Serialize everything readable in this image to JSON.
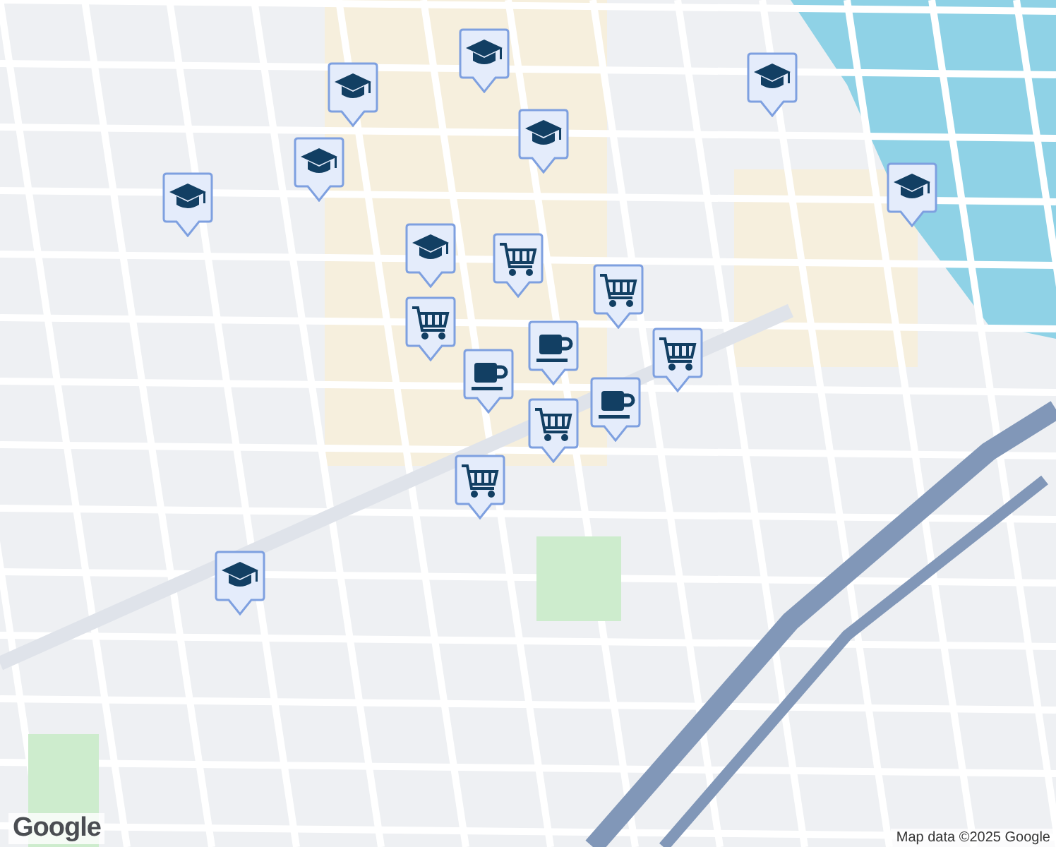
{
  "map": {
    "markers": [
      {
        "kind": "school"
      },
      {
        "kind": "school"
      },
      {
        "kind": "school"
      },
      {
        "kind": "school"
      },
      {
        "kind": "school"
      },
      {
        "kind": "school"
      },
      {
        "kind": "school"
      },
      {
        "kind": "school"
      },
      {
        "kind": "school"
      },
      {
        "kind": "shop"
      },
      {
        "kind": "shop"
      },
      {
        "kind": "shop"
      },
      {
        "kind": "shop"
      },
      {
        "kind": "cafe"
      },
      {
        "kind": "cafe"
      },
      {
        "kind": "cafe"
      },
      {
        "kind": "shop"
      },
      {
        "kind": "shop"
      }
    ],
    "logo": "Google",
    "attribution": "Map data ©2025 Google"
  }
}
